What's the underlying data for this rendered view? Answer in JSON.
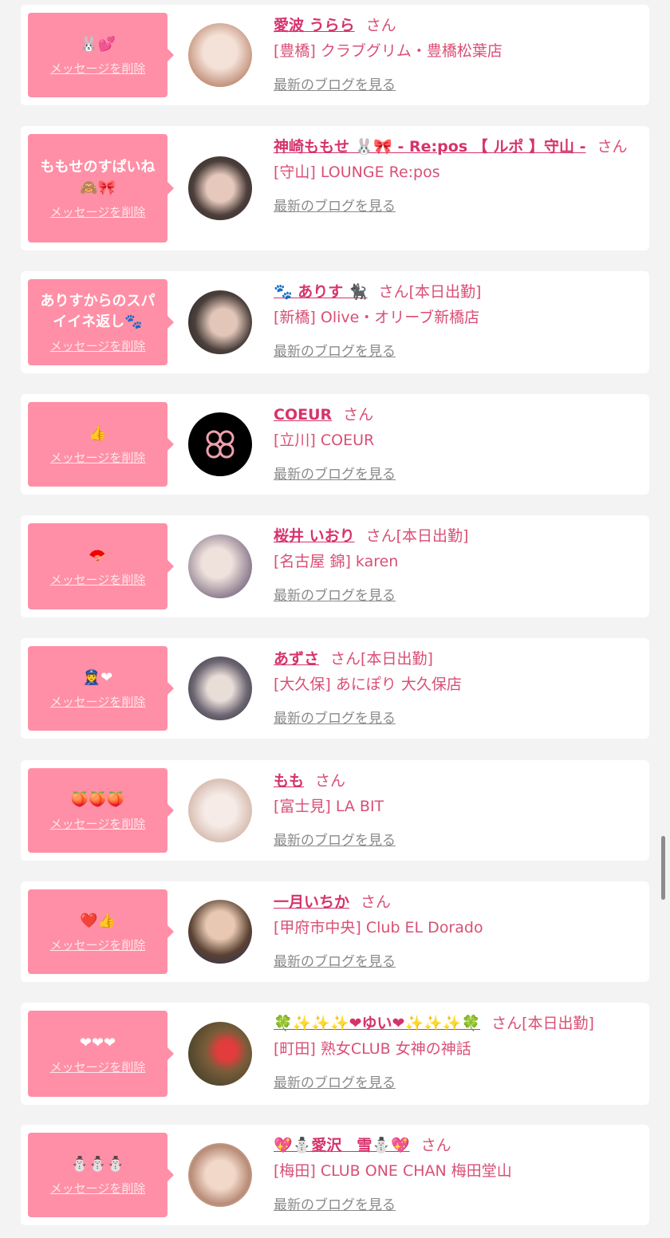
{
  "delete_label": "メッセージを削除",
  "blog_label": "最新のブログを見る",
  "san": "さん",
  "items": [
    {
      "msg": "🐰💕",
      "name": "愛波 うらら",
      "status": "",
      "shop": "[豊橋] クラブグリム・豊橋松葉店",
      "avatar_colors": [
        "#e9d4c7",
        "#b58a77"
      ]
    },
    {
      "msg": "ももせのすぱいね🙈🎀",
      "name": "神崎ももせ 🐰🎀 - Re:pos 【 ルポ 】守山 -",
      "status": "",
      "shop": "[守山] LOUNGE Re:pos",
      "avatar_colors": [
        "#5a4a46",
        "#d9b8aa"
      ]
    },
    {
      "msg": "ありすからのスパイイネ返し🐾",
      "name": "🐾 ありす 🐈‍⬛",
      "status": "[本日出勤]",
      "shop": "[新橋] Olive・オリーブ新橋店",
      "avatar_colors": [
        "#3a3433",
        "#cdb4a6"
      ]
    },
    {
      "msg": "👍",
      "name": "COEUR",
      "status": "",
      "shop": "[立川] COEUR",
      "avatar_colors": [
        "#000000",
        "#000000"
      ]
    },
    {
      "msg": "🪭",
      "name": "桜井 いおり",
      "status": "[本日出勤]",
      "shop": "[名古屋 錦] karen",
      "avatar_colors": [
        "#cbb4b0",
        "#7f6e7e"
      ]
    },
    {
      "msg": "👮‍♀️❤",
      "name": "あずさ",
      "status": "[本日出勤]",
      "shop": "[大久保] あにぽり 大久保店",
      "avatar_colors": [
        "#2b2a2c",
        "#9da0b3"
      ]
    },
    {
      "msg": "🍑🍑🍑",
      "name": "もも",
      "status": "",
      "shop": "[富士見] LA BIT",
      "avatar_colors": [
        "#f2e6e2",
        "#c49d8e"
      ]
    },
    {
      "msg": "❤️👍",
      "name": "一月いちか",
      "status": "",
      "shop": "[甲府市中央] Club EL Dorado",
      "avatar_colors": [
        "#3c2b22",
        "#2a3a78"
      ]
    },
    {
      "msg": "❤❤❤",
      "name": "🍀✨✨✨❤ゆい❤✨✨✨🍀",
      "status": "[本日出勤]",
      "shop": "[町田] 熟女CLUB 女神の神話",
      "avatar_colors": [
        "#3d3b26",
        "#e23c3c"
      ]
    },
    {
      "msg": "⛄⛄⛄",
      "name": "💖⛄愛沢　雪⛄💖",
      "status": "",
      "shop": "[梅田] CLUB ONE CHAN 梅田堂山",
      "avatar_colors": [
        "#d9b39c",
        "#8a6b5a"
      ]
    }
  ]
}
